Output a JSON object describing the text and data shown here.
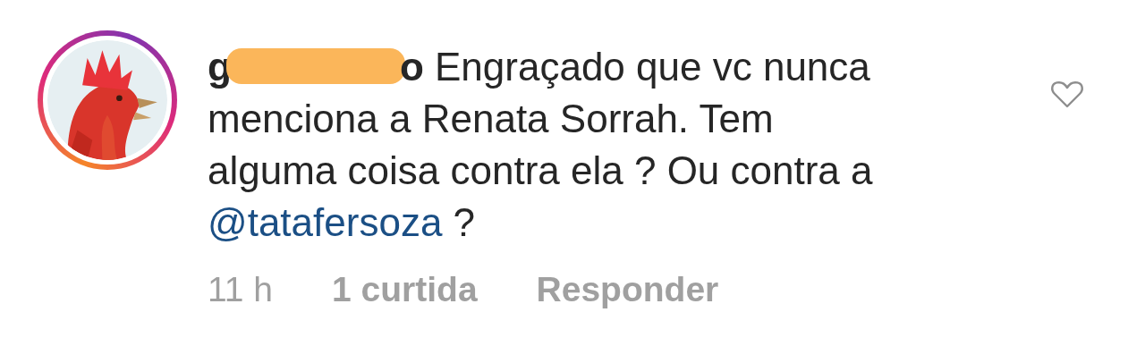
{
  "comment": {
    "avatar": {
      "kind": "picture",
      "story_ring": true
    },
    "username_start": "g",
    "username_end": "o",
    "text": "Engraçado que vc nunca menciona a Renata Sorrah. Tem alguma coisa contra ela ? Ou contra a",
    "mention": "@tatafersoza",
    "text_after": " ?",
    "liked": false
  },
  "meta": {
    "time": "11 h",
    "likes": "1 curtida",
    "reply": "Responder"
  }
}
